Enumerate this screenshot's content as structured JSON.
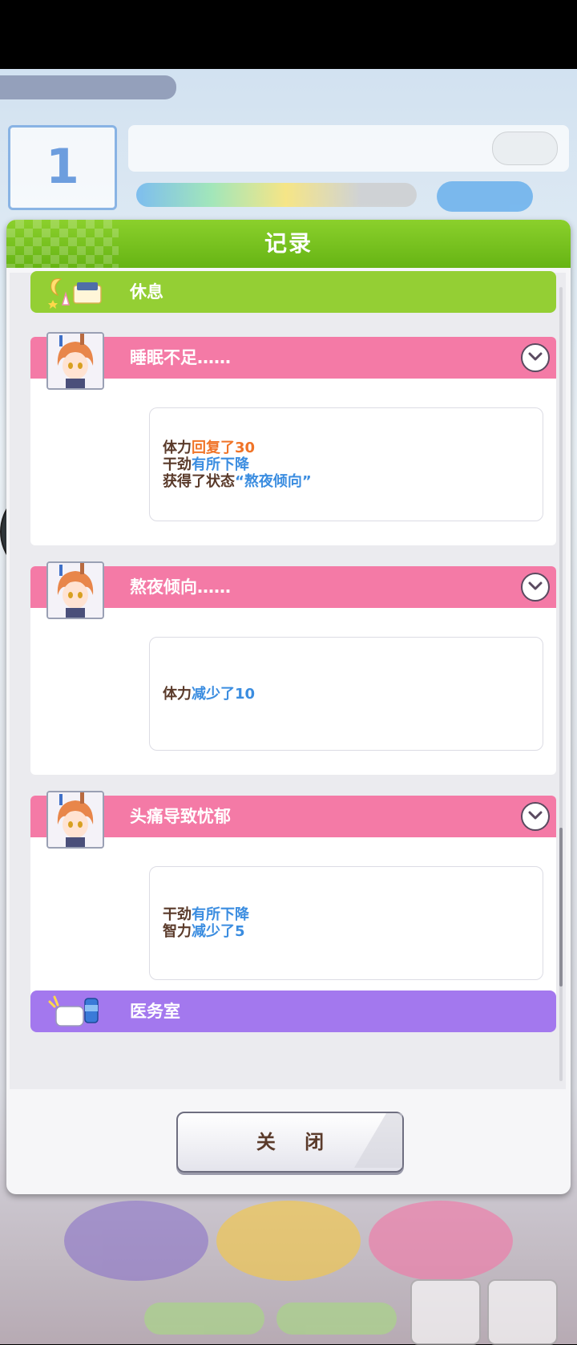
{
  "dialog": {
    "title": "记录",
    "close_label": "关 闭"
  },
  "categories": {
    "rest": {
      "label": "休息",
      "icon": "rest-icon"
    },
    "medical": {
      "label": "医务室",
      "icon": "medical-icon"
    }
  },
  "events": [
    {
      "title": "睡眠不足……",
      "lines": [
        {
          "prefix": "体力",
          "highlight": "回复了30",
          "color": "orange"
        },
        {
          "prefix": "干劲",
          "highlight": "有所下降",
          "color": "blue"
        },
        {
          "prefix": "获得了状态",
          "highlight": "“熬夜倾向”",
          "color": "blue"
        }
      ]
    },
    {
      "title": "熬夜倾向……",
      "lines": [
        {
          "prefix": "体力",
          "highlight": "减少了10",
          "color": "blue"
        }
      ]
    },
    {
      "title": "头痛导致忧郁",
      "lines": [
        {
          "prefix": "干劲",
          "highlight": "有所下降",
          "color": "blue"
        },
        {
          "prefix": "智力",
          "highlight": "减少了5",
          "color": "blue"
        }
      ]
    }
  ],
  "hud": {
    "turn_number": "1"
  },
  "colors": {
    "header_green": "#7cc521",
    "event_pink": "#f47aa6",
    "rest_green": "#94cf34",
    "medical_purple": "#a378ee",
    "highlight_orange": "#f07428",
    "highlight_blue": "#3b8de0"
  }
}
